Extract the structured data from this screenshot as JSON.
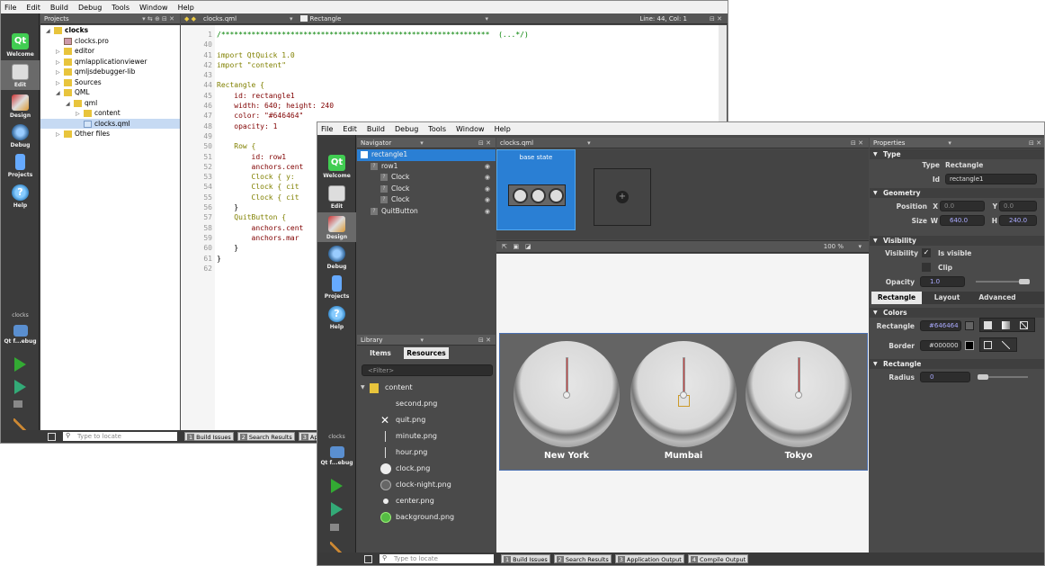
{
  "back_window": {
    "menu": [
      "File",
      "Edit",
      "Build",
      "Debug",
      "Tools",
      "Window",
      "Help"
    ],
    "modes": [
      "Welcome",
      "Edit",
      "Design",
      "Debug",
      "Projects",
      "Help"
    ],
    "active_mode": "Edit",
    "project_label": "clocks",
    "target_label": "Qt f...ebug",
    "projects_panel": {
      "title": "Projects",
      "tree": [
        {
          "label": "clocks",
          "depth": 0,
          "icon": "folder"
        },
        {
          "label": "clocks.pro",
          "depth": 1,
          "icon": "pro"
        },
        {
          "label": "editor",
          "depth": 1,
          "icon": "folder"
        },
        {
          "label": "qmlapplicationviewer",
          "depth": 1,
          "icon": "folder"
        },
        {
          "label": "qmljsdebugger-lib",
          "depth": 1,
          "icon": "folder"
        },
        {
          "label": "Sources",
          "depth": 1,
          "icon": "folder"
        },
        {
          "label": "QML",
          "depth": 1,
          "icon": "folder"
        },
        {
          "label": "qml",
          "depth": 2,
          "icon": "folder"
        },
        {
          "label": "content",
          "depth": 3,
          "icon": "folder"
        },
        {
          "label": "clocks.qml",
          "depth": 3,
          "icon": "qfile",
          "selected": true
        },
        {
          "label": "Other files",
          "depth": 1,
          "icon": "folder"
        }
      ]
    },
    "editor": {
      "file": "clocks.qml",
      "symbol": "Rectangle",
      "position": "Line: 44, Col: 1",
      "line_numbers": [
        "1",
        "40",
        "41",
        "42",
        "43",
        "44",
        "45",
        "46",
        "47",
        "48",
        "49",
        "50",
        "51",
        "52",
        "53",
        "54",
        "55",
        "56",
        "57",
        "58",
        "59",
        "60",
        "61",
        "62"
      ],
      "lines": [
        "/**************************************************************  (...*/)",
        "",
        "import QtQuick 1.0",
        "import \"content\"",
        "",
        "Rectangle {",
        "    id: rectangle1",
        "    width: 640; height: 240",
        "    color: \"#646464\"",
        "    opacity: 1",
        "",
        "    Row {",
        "        id: row1",
        "        anchors.cent",
        "        Clock { y: ",
        "        Clock { cit",
        "        Clock { cit",
        "    }",
        "    QuitButton {",
        "        anchors.cent",
        "        anchors.mar",
        "    }",
        "}",
        ""
      ]
    },
    "statusbar": {
      "locate_placeholder": "Type to locate",
      "buttons": [
        {
          "num": "1",
          "label": "Build Issues"
        },
        {
          "num": "2",
          "label": "Search Results"
        },
        {
          "num": "3",
          "label": "Appli"
        }
      ]
    }
  },
  "front_window": {
    "menu": [
      "File",
      "Edit",
      "Build",
      "Debug",
      "Tools",
      "Window",
      "Help"
    ],
    "modes": [
      "Welcome",
      "Edit",
      "Design",
      "Debug",
      "Projects",
      "Help"
    ],
    "active_mode": "Design",
    "project_label": "clocks",
    "target_label": "Qt f...ebug",
    "navigator": {
      "title": "Navigator",
      "items": [
        {
          "label": "rectangle1",
          "depth": 0,
          "selected": true
        },
        {
          "label": "row1",
          "depth": 1
        },
        {
          "label": "Clock",
          "depth": 2
        },
        {
          "label": "Clock",
          "depth": 2
        },
        {
          "label": "Clock",
          "depth": 2
        },
        {
          "label": "QuitButton",
          "depth": 1
        }
      ]
    },
    "library": {
      "title": "Library",
      "tabs": [
        "Items",
        "Resources"
      ],
      "active_tab": "Resources",
      "filter_placeholder": "<Filter>",
      "folder": "content",
      "files": [
        "second.png",
        "quit.png",
        "minute.png",
        "hour.png",
        "clock.png",
        "clock-night.png",
        "center.png",
        "background.png"
      ]
    },
    "canvas": {
      "file": "clocks.qml",
      "state_label": "base state",
      "zoom": "100 %",
      "clock_labels": [
        "New York",
        "Mumbai",
        "Tokyo"
      ]
    },
    "properties": {
      "title": "Properties",
      "type_section": "Type",
      "type_label": "Type",
      "type_value": "Rectangle",
      "id_label": "Id",
      "id_value": "rectangle1",
      "geometry_section": "Geometry",
      "position_label": "Position",
      "x_label": "X",
      "x_value": "0.0",
      "y_label": "Y",
      "y_value": "0.0",
      "size_label": "Size",
      "w_label": "W",
      "w_value": "640.0",
      "h_label": "H",
      "h_value": "240.0",
      "visibility_section": "Visibility",
      "visibility_label": "Visibility",
      "is_visible_label": "Is visible",
      "clip_label": "Clip",
      "opacity_label": "Opacity",
      "opacity_value": "1.0",
      "tabs": [
        "Rectangle",
        "Layout",
        "Advanced"
      ],
      "active_tab": "Rectangle",
      "colors_section": "Colors",
      "rect_color_label": "Rectangle",
      "rect_color_value": "#646464",
      "border_label": "Border",
      "border_value": "#000000",
      "rectangle_section": "Rectangle",
      "radius_label": "Radius",
      "radius_value": "0"
    },
    "statusbar": {
      "locate_placeholder": "Type to locate",
      "buttons": [
        {
          "num": "1",
          "label": "Build Issues"
        },
        {
          "num": "2",
          "label": "Search Results"
        },
        {
          "num": "3",
          "label": "Application Output"
        },
        {
          "num": "4",
          "label": "Compile Output"
        }
      ]
    }
  }
}
